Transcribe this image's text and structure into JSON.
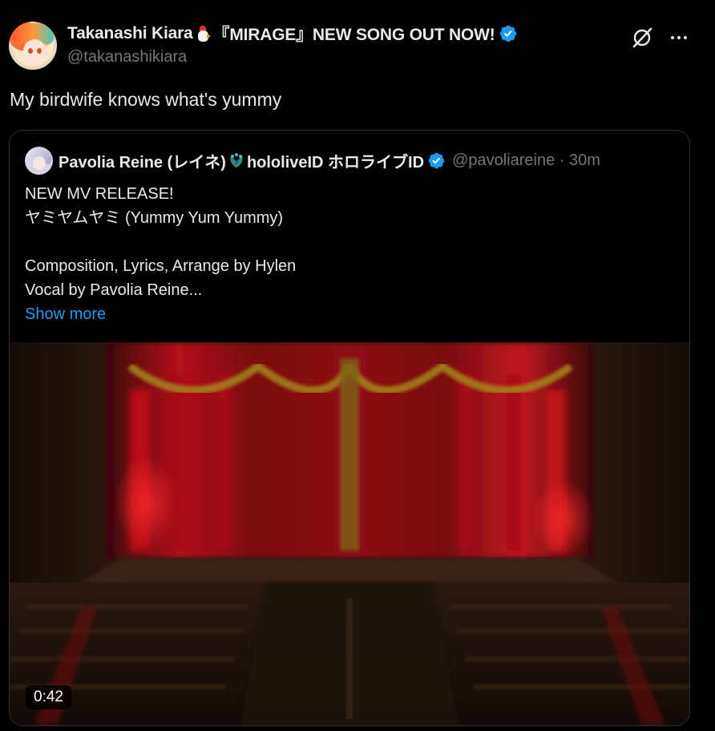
{
  "author": {
    "display_name": "Takanashi Kiara",
    "title_suffix": "『MIRAGE』NEW SONG OUT NOW!",
    "handle": "@takanashikiara",
    "verified": true,
    "name_emoji": "chicken-emoji"
  },
  "tweet": {
    "text": "My birdwife knows what's yummy"
  },
  "header_actions": {
    "grok_icon": "grok-icon",
    "more_icon": "more-icon"
  },
  "quote": {
    "display_name_start": "Pavolia Reine (レイネ)",
    "display_name_end": "hololiveID ホロライブID",
    "name_emoji": "peacock-emoji",
    "verified": true,
    "handle_time": "@pavoliareine · 30m",
    "lines": [
      "NEW MV RELEASE!",
      "ヤミヤムヤミ (Yummy Yum Yummy)",
      "",
      "Composition, Lyrics, Arrange by Hylen",
      "Vocal by Pavolia Reine..."
    ],
    "show_more": "Show more",
    "video": {
      "duration": "0:42",
      "scene": "theater-stage-red-curtain"
    }
  },
  "colors": {
    "background": "#000000",
    "text": "#e7e9ea",
    "muted": "#71767b",
    "link": "#1d9bf0",
    "border": "#2f3336",
    "verified": "#1d9bf0"
  }
}
